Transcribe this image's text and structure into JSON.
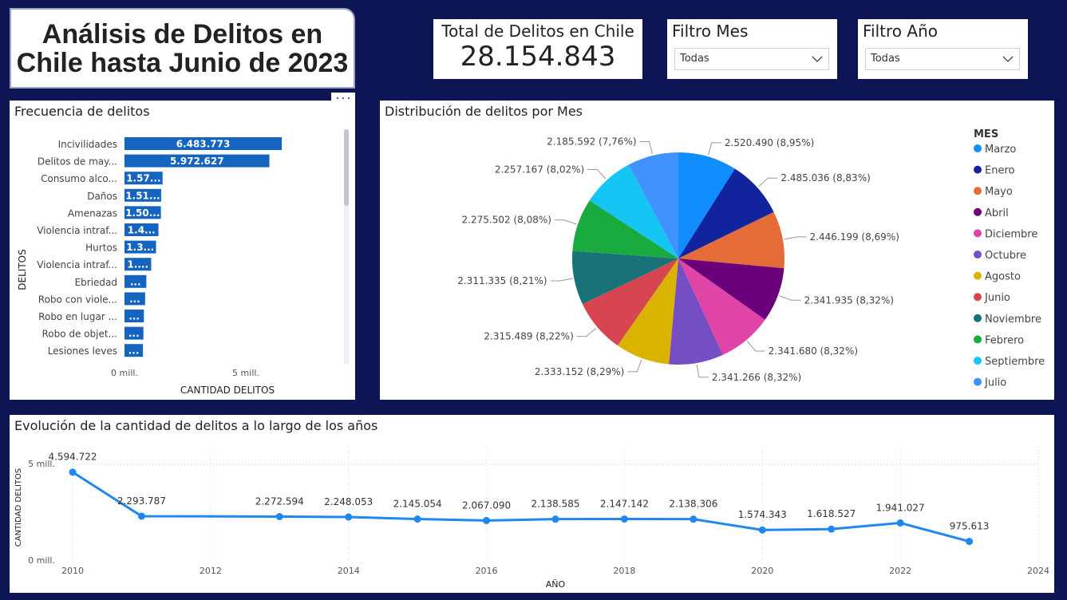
{
  "title": "Análisis de Delitos en Chile hasta Junio de 2023",
  "total": {
    "label": "Total de Delitos en Chile",
    "value": "28.154.843"
  },
  "filters": {
    "mes": {
      "label": "Filtro Mes",
      "value": "Todas"
    },
    "anio": {
      "label": "Filtro Año",
      "value": "Todas"
    }
  },
  "freq_chart": {
    "title": "Frecuencia de delitos",
    "ylabel": "DELITOS",
    "xlabel": "CANTIDAD DELITOS",
    "ticks": [
      "0 mill.",
      "5 mill."
    ]
  },
  "pie_chart": {
    "title": "Distribución de delitos por Mes",
    "legend_title": "MES"
  },
  "line_chart": {
    "title": "Evolución de la cantidad de delitos a lo largo de los años",
    "ylabel": "CANTIDAD DELITOS",
    "xlabel": "AÑO",
    "yticks": [
      "5 mill.",
      "0 mill."
    ]
  },
  "colors": {
    "background": "#0d1554",
    "bar": "#1565c0",
    "line": "#1e88f0"
  },
  "chart_data": [
    {
      "type": "bar",
      "title": "Frecuencia de delitos",
      "xlabel": "CANTIDAD DELITOS",
      "ylabel": "DELITOS",
      "xlim": [
        0,
        6800000
      ],
      "categories": [
        "Incivilidades",
        "Delitos de may...",
        "Consumo alco...",
        "Daños",
        "Amenazas",
        "Violencia intraf...",
        "Hurtos",
        "Violencia intraf...",
        "Ebriedad",
        "Robo con viole...",
        "Robo en lugar ...",
        "Robo de objet...",
        "Lesiones leves"
      ],
      "values": [
        6483773,
        5972627,
        1570000,
        1510000,
        1500000,
        1400000,
        1300000,
        1100000,
        900000,
        850000,
        800000,
        780000,
        760000
      ],
      "labels": [
        "6.483.773",
        "5.972.627",
        "1.57...",
        "1.51...",
        "1.50...",
        "1.4...",
        "1.3...",
        "1....",
        "...",
        "...",
        "...",
        "...",
        "..."
      ]
    },
    {
      "type": "pie",
      "title": "Distribución de delitos por Mes",
      "legend": "right",
      "slices": [
        {
          "name": "Marzo",
          "value": 2520490,
          "label": "2.520.490 (8,95%)",
          "color": "#118dff"
        },
        {
          "name": "Enero",
          "value": 2485036,
          "label": "2.485.036 (8,83%)",
          "color": "#12239e"
        },
        {
          "name": "Mayo",
          "value": 2446199,
          "label": "2.446.199 (8,69%)",
          "color": "#e66c37"
        },
        {
          "name": "Abril",
          "value": 2341935,
          "label": "2.341.935 (8,32%)",
          "color": "#6b007b"
        },
        {
          "name": "Diciembre",
          "value": 2341680,
          "label": "2.341.680 (8,32%)",
          "color": "#e044a7"
        },
        {
          "name": "Octubre",
          "value": 2341266,
          "label": "2.341.266 (8,32%)",
          "color": "#744ec2"
        },
        {
          "name": "Agosto",
          "value": 2333152,
          "label": "2.333.152 (8,29%)",
          "color": "#d9b300"
        },
        {
          "name": "Junio",
          "value": 2315489,
          "label": "2.315.489 (8,22%)",
          "color": "#d64550"
        },
        {
          "name": "Noviembre",
          "value": 2311335,
          "label": "2.311.335 (8,21%)",
          "color": "#197278"
        },
        {
          "name": "Febrero",
          "value": 2275502,
          "label": "2.275.502 (8,08%)",
          "color": "#1aab40"
        },
        {
          "name": "Septiembre",
          "value": 2257167,
          "label": "2.257.167 (8,02%)",
          "color": "#15c6f4"
        },
        {
          "name": "Julio",
          "value": 2185592,
          "label": "2.185.592 (7,76%)",
          "color": "#4092ff"
        }
      ]
    },
    {
      "type": "line",
      "title": "Evolución de la cantidad de delitos a lo largo de los años",
      "xlabel": "AÑO",
      "ylabel": "CANTIDAD DELITOS",
      "xlim": [
        2010,
        2024
      ],
      "ylim": [
        0,
        5000000
      ],
      "xticks": [
        2010,
        2012,
        2014,
        2016,
        2018,
        2020,
        2022,
        2024
      ],
      "x": [
        2010,
        2011,
        2013,
        2014,
        2015,
        2016,
        2017,
        2018,
        2019,
        2020,
        2021,
        2022,
        2023
      ],
      "y": [
        4594722,
        2293787,
        2272594,
        2248053,
        2145054,
        2067090,
        2138585,
        2147142,
        2138306,
        1574343,
        1618527,
        1941027,
        975613
      ],
      "labels": [
        "4.594.722",
        "2.293.787",
        "2.272.594",
        "2.248.053",
        "2.145.054",
        "2.067.090",
        "2.138.585",
        "2.147.142",
        "2.138.306",
        "1.574.343",
        "1.618.527",
        "1.941.027",
        "975.613"
      ]
    }
  ]
}
